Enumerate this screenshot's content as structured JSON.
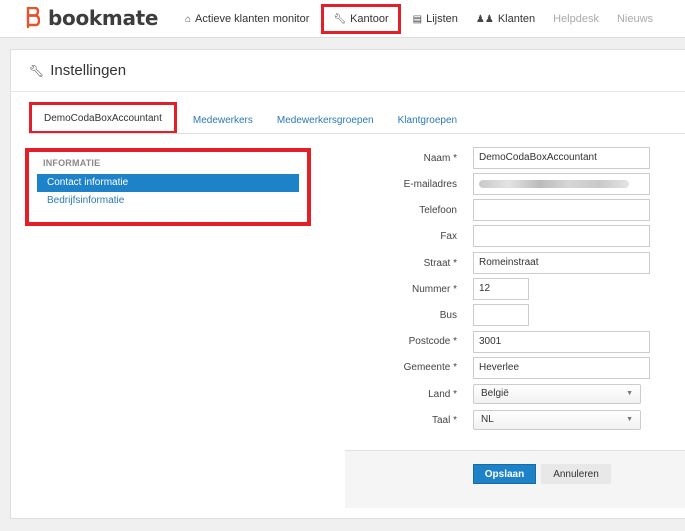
{
  "brand": {
    "name": "bookmate",
    "color": "#e5532d"
  },
  "nav": {
    "items": [
      {
        "label": "Actieve klanten monitor",
        "icon": "home-icon"
      },
      {
        "label": "Kantoor",
        "icon": "wrench-icon",
        "active": true
      },
      {
        "label": "Lijsten",
        "icon": "list-icon"
      },
      {
        "label": "Klanten",
        "icon": "users-icon"
      },
      {
        "label": "Helpdesk",
        "disabled": true
      },
      {
        "label": "Nieuws",
        "disabled": true
      }
    ]
  },
  "page": {
    "title": "Instellingen",
    "icon": "wrench-icon"
  },
  "tabs": [
    "DemoCodaBoxAccountant",
    "Medewerkers",
    "Medewerkersgroepen",
    "Klantgroepen"
  ],
  "menu": {
    "header": "INFORMATIE",
    "items": [
      "Contact informatie",
      "Bedrijfsinformatie"
    ]
  },
  "form": {
    "naam": {
      "label": "Naam *",
      "value": "DemoCodaBoxAccountant"
    },
    "email": {
      "label": "E-mailadres",
      "value": ""
    },
    "telefoon": {
      "label": "Telefoon",
      "value": ""
    },
    "fax": {
      "label": "Fax",
      "value": ""
    },
    "straat": {
      "label": "Straat *",
      "value": "Romeinstraat"
    },
    "nummer": {
      "label": "Nummer *",
      "value": "12"
    },
    "bus": {
      "label": "Bus",
      "value": ""
    },
    "postcode": {
      "label": "Postcode *",
      "value": "3001"
    },
    "gemeente": {
      "label": "Gemeente *",
      "value": "Heverlee"
    },
    "land": {
      "label": "Land *",
      "value": "België"
    },
    "taal": {
      "label": "Taal *",
      "value": "NL"
    }
  },
  "actions": {
    "save": "Opslaan",
    "cancel": "Annuleren"
  },
  "colors": {
    "highlight": "#e3202a",
    "primary": "#1e82c8",
    "link": "#2a7ab8"
  }
}
